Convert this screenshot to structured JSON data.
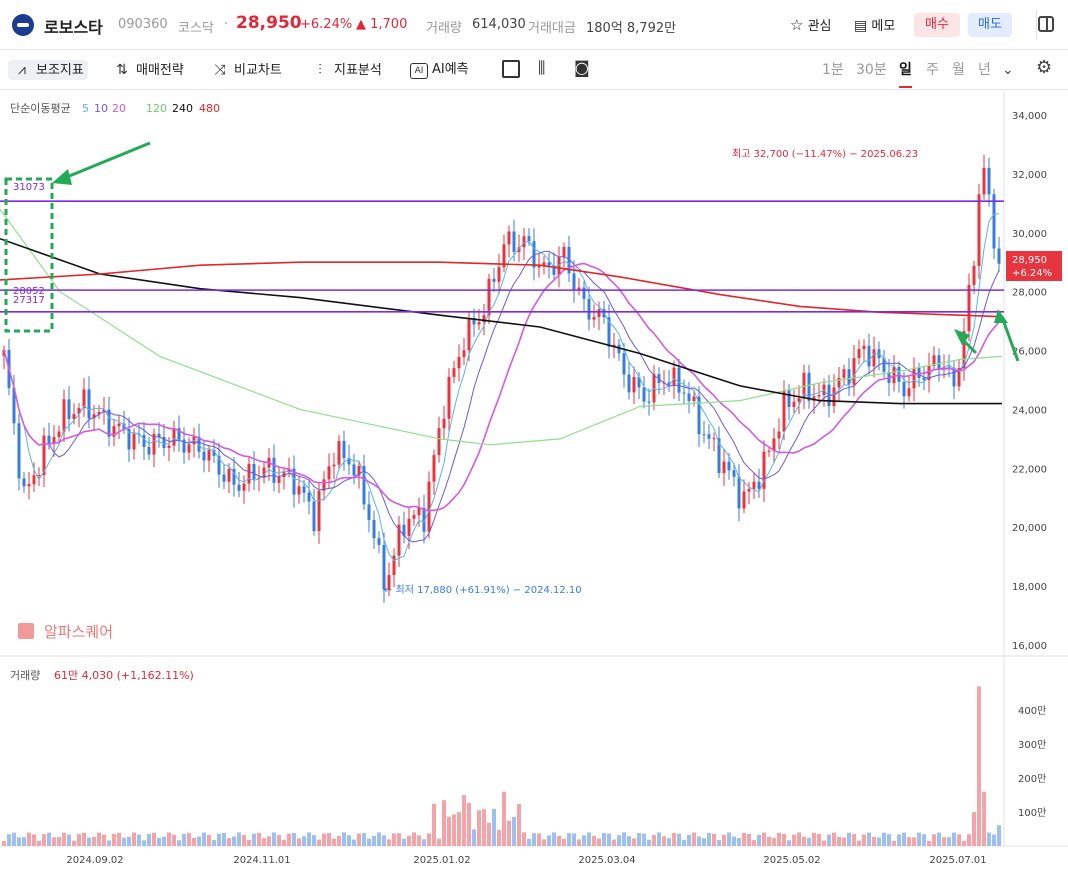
{
  "header": {
    "stock_name": "로보스타",
    "code": "090360",
    "market": "코스닥",
    "dot": "·",
    "price": "28,950",
    "change_pct": "+6.24%",
    "change_abs": "▲ 1,700",
    "volume_label": "거래량",
    "volume": "614,030",
    "amount_label": "거래대금",
    "amount": "180억 8,792만",
    "watch_label": "관심",
    "memo_label": "메모",
    "buy_label": "매수",
    "sell_label": "매도"
  },
  "toolbar": {
    "indicator_label": "보조지표",
    "strategy_label": "매매전략",
    "compare_label": "비교차트",
    "analysis_label": "지표분석",
    "ai_label": "AI예측",
    "timeframes": [
      "1분",
      "30분",
      "일",
      "주",
      "월",
      "년"
    ],
    "active_timeframe": "일"
  },
  "colors": {
    "up": "#e8343e",
    "down": "#3a7be0",
    "ma5": "#5ab4e8",
    "ma10": "#6a5ae0",
    "ma20": "#d45ae0",
    "ma120": "#8ee08a",
    "ma240": "#111111",
    "ma480": "#e02828",
    "hline": "#7a2be8",
    "annot_box": "#22aa55",
    "arrow": "#22aa55"
  },
  "chart_data": {
    "type": "candlestick",
    "legend": {
      "label": "단순이동평균",
      "periods": [
        "5",
        "10",
        "20",
        "120",
        "240",
        "480"
      ]
    },
    "y_ticks": [
      "34,000",
      "32,000",
      "30,000",
      "28,000",
      "26,000",
      "24,000",
      "22,000",
      "20,000",
      "18,000",
      "16,000"
    ],
    "y_range": [
      16000,
      34000
    ],
    "x_ticks": [
      "2024.09.02",
      "2024.11.01",
      "2025.01.02",
      "2025.03.04",
      "2025.05.02",
      "2025.07.01"
    ],
    "current_price": "28,950",
    "current_change": "+6.24%",
    "high_annotation": "최고 32,700 (−11.47%) − 2025.06.23",
    "low_annotation": "← 최저 17,880 (+61.91%) − 2024.12.10",
    "horizontal_lines": [
      {
        "label": "31073",
        "value": 31073
      },
      {
        "label": "28052",
        "value": 28052
      },
      {
        "label": "27317",
        "value": 27317
      }
    ],
    "watermark": "알파스퀘어",
    "volume": {
      "label": "거래량",
      "value_text": "61만 4,030 (+1,162.11%)",
      "ticks": [
        "400만",
        "300만",
        "200만",
        "100만"
      ],
      "range": [
        0,
        4800000
      ]
    }
  }
}
